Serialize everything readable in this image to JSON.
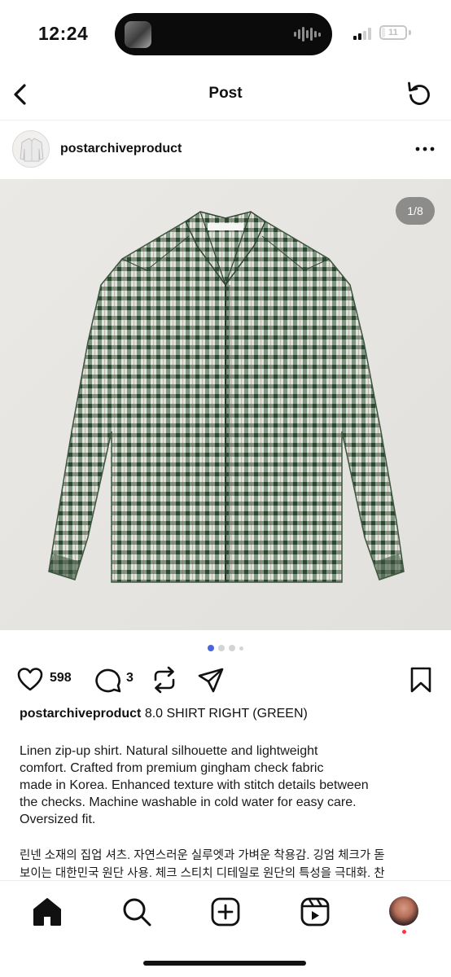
{
  "status_bar": {
    "time": "12:24",
    "battery": "11"
  },
  "nav": {
    "title": "Post",
    "back_icon": "chevron-left-icon",
    "refresh_icon": "refresh-icon"
  },
  "post": {
    "username": "postarchiveproduct",
    "more_icon": "more-horizontal-icon",
    "media": {
      "counter": "1/8",
      "current_index": 1,
      "total": 8,
      "description": "green gingham check zip-up shirt on beige background"
    },
    "actions": {
      "likes": "598",
      "comments": "3"
    },
    "caption": {
      "username": "postarchiveproduct",
      "title": "8.0 SHIRT RIGHT (GREEN)",
      "description": [
        "Linen zip-up shirt. Natural silhouette and lightweight",
        "comfort. Crafted from premium gingham check fabric",
        "made in Korea. Enhanced texture with stitch details between",
        "the checks. Machine washable in cold water for easy care.",
        "Oversized fit."
      ],
      "description_kr": [
        "린넨 소재의 집업 셔츠. 자연스러운 실루엣과 가벼운 착용감. 깅엄 체크가 돋",
        "보이는 대한민국 원단 사용. 체크 스티치 디테일로 원단의 특성을 극대화. 찬"
      ]
    }
  },
  "tab_bar": {
    "items": [
      "home-icon",
      "search-icon",
      "create-icon",
      "reels-icon",
      "profile-avatar"
    ]
  },
  "colors": {
    "accent_dot": "#4a66d8",
    "notification": "#ff3040",
    "text": "#111111"
  }
}
